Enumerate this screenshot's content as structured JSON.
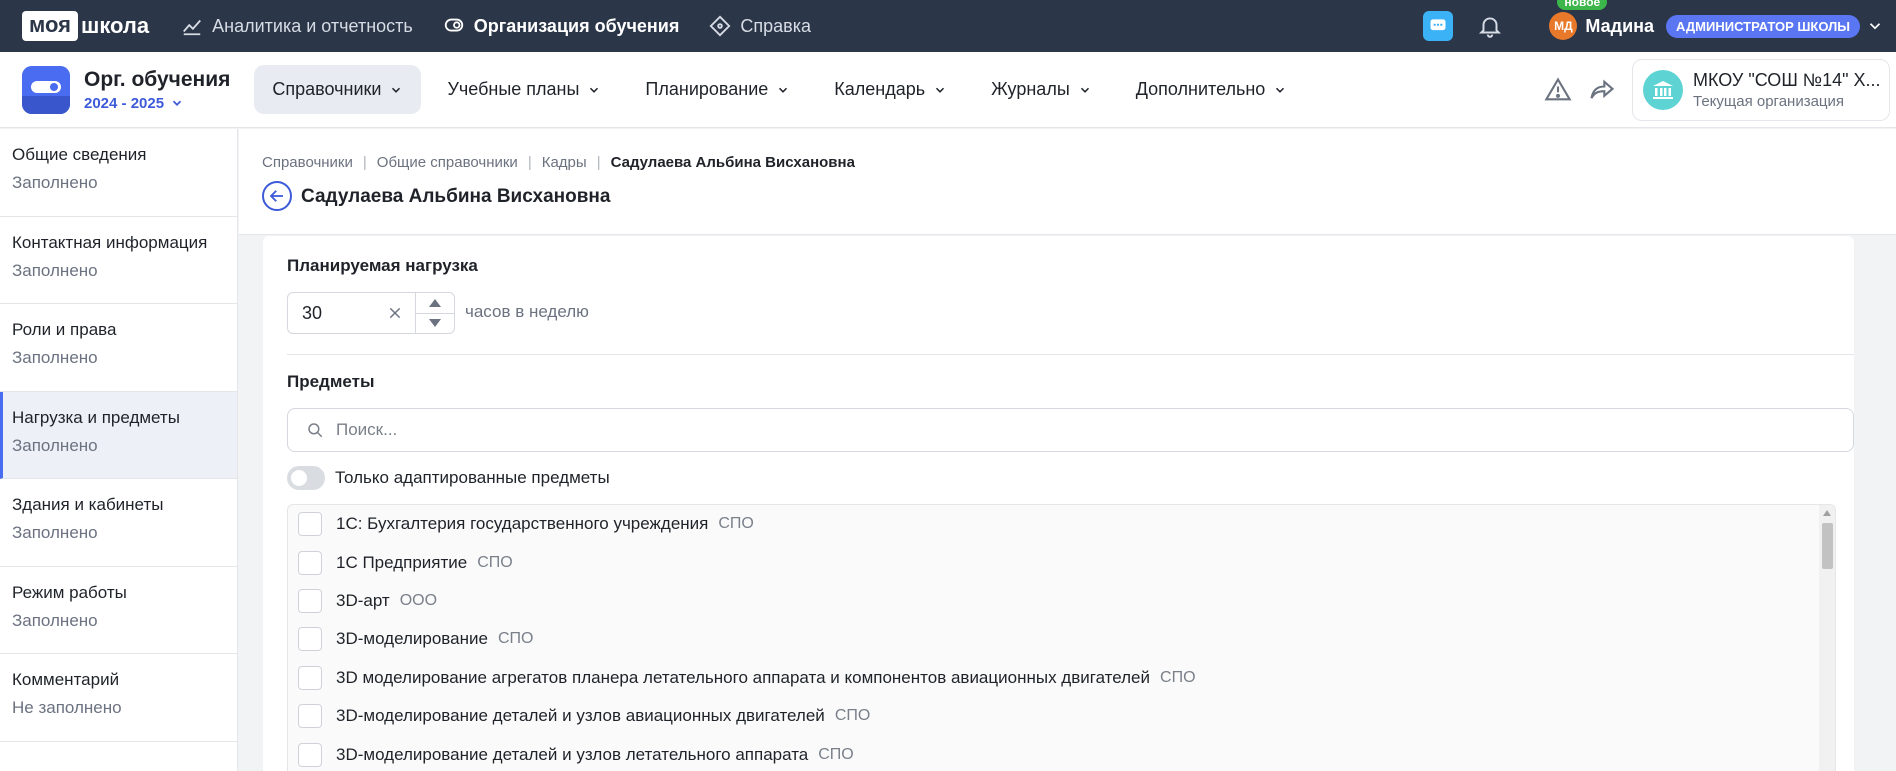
{
  "topbar": {
    "logo_box": "моя",
    "logo_text": "школа",
    "nav": [
      {
        "label": "Аналитика и отчетность",
        "icon": "analytics-icon"
      },
      {
        "label": "Организация обучения",
        "icon": "organization-icon",
        "active": true
      },
      {
        "label": "Справка",
        "icon": "help-icon"
      }
    ],
    "user": {
      "initials": "МД",
      "new_badge": "новое",
      "name": "Мадина",
      "role": "АДМИНИСТРАТОР ШКОЛЫ"
    }
  },
  "subheader": {
    "app_title": "Орг. обучения",
    "year": "2024 - 2025",
    "nav": [
      {
        "label": "Справочники",
        "active": true
      },
      {
        "label": "Учебные планы"
      },
      {
        "label": "Планирование"
      },
      {
        "label": "Календарь"
      },
      {
        "label": "Журналы"
      },
      {
        "label": "Дополнительно"
      }
    ],
    "org": {
      "name": "МКОУ \"СОШ №14\" Х...",
      "caption": "Текущая организация"
    }
  },
  "sidebar": {
    "items": [
      {
        "title": "Общие сведения",
        "status": "Заполнено"
      },
      {
        "title": "Контактная информация",
        "status": "Заполнено"
      },
      {
        "title": "Роли и права",
        "status": "Заполнено"
      },
      {
        "title": "Нагрузка и предметы",
        "status": "Заполнено",
        "active": true
      },
      {
        "title": "Здания и кабинеты",
        "status": "Заполнено"
      },
      {
        "title": "Режим работы",
        "status": "Заполнено"
      },
      {
        "title": "Комментарий",
        "status": "Не заполнено"
      }
    ]
  },
  "page": {
    "breadcrumbs": [
      "Справочники",
      "Общие справочники",
      "Кадры",
      "Садулаева Альбина Висхановна"
    ],
    "title": "Садулаева Альбина Висхановна"
  },
  "workload": {
    "label": "Планируемая нагрузка",
    "value": "30",
    "unit": "часов в неделю"
  },
  "subjects": {
    "label": "Предметы",
    "search_placeholder": "Поиск...",
    "toggle_label": "Только адаптированные предметы",
    "items": [
      {
        "name": "1С: Бухгалтерия государственного учреждения",
        "tag": "СПО"
      },
      {
        "name": "1С Предприятие",
        "tag": "СПО"
      },
      {
        "name": "3D-арт",
        "tag": "ООО"
      },
      {
        "name": "3D-моделирование",
        "tag": "СПО"
      },
      {
        "name": "3D моделирование агрегатов планера летательного аппарата и компонентов авиационных двигателей",
        "tag": "СПО"
      },
      {
        "name": "3D-моделирование деталей и узлов авиационных двигателей",
        "tag": "СПО"
      },
      {
        "name": "3D-моделирование деталей и узлов летательного аппарата",
        "tag": "СПО"
      }
    ]
  }
}
